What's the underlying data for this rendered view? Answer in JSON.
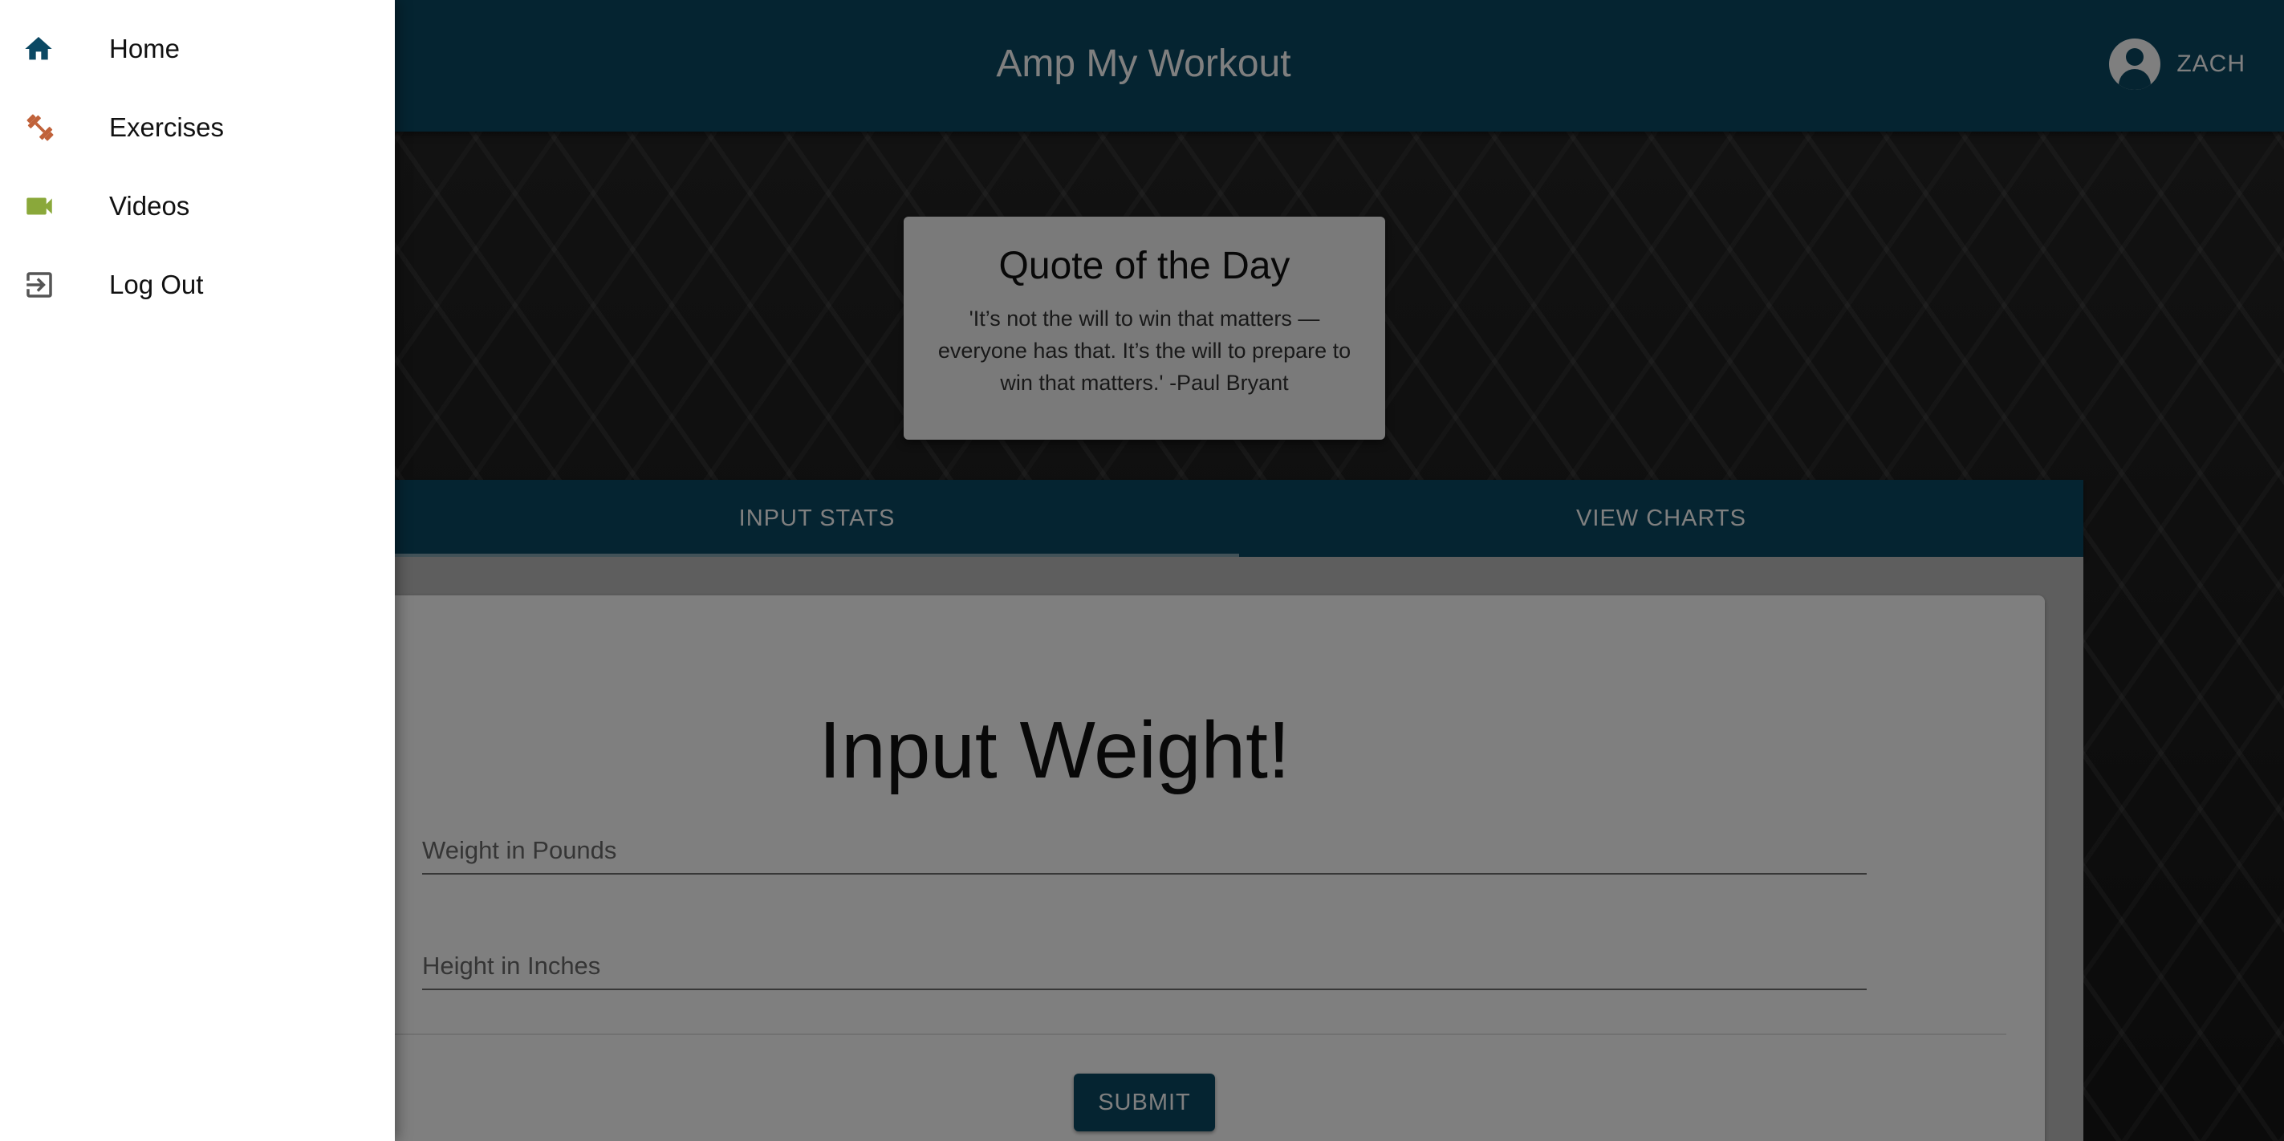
{
  "app": {
    "title": "Amp My Workout",
    "user_name": "ZACH"
  },
  "quote": {
    "title": "Quote of the Day",
    "text": "'It’s not the will to win that matters — everyone has that. It’s the will to prepare to win that matters.' -Paul Bryant"
  },
  "tabs": [
    {
      "label": "INPUT STATS",
      "selected": true
    },
    {
      "label": "VIEW CHARTS",
      "selected": false
    }
  ],
  "form": {
    "heading": "Input Weight!",
    "weight_placeholder": "Weight in Pounds",
    "height_placeholder": "Height in Inches",
    "submit_label": "SUBMIT"
  },
  "drawer": {
    "items": [
      {
        "label": "Home",
        "icon": "home-icon",
        "color": "#0b4863"
      },
      {
        "label": "Exercises",
        "icon": "dumbbell-icon",
        "color": "#c0623a"
      },
      {
        "label": "Videos",
        "icon": "video-camera-icon",
        "color": "#8aa83a"
      },
      {
        "label": "Log Out",
        "icon": "logout-icon",
        "color": "#555555"
      }
    ]
  },
  "colors": {
    "primary": "#0b4863",
    "drawer_background": "#ffffff",
    "backdrop": "rgba(0,0,0,0.5)"
  }
}
